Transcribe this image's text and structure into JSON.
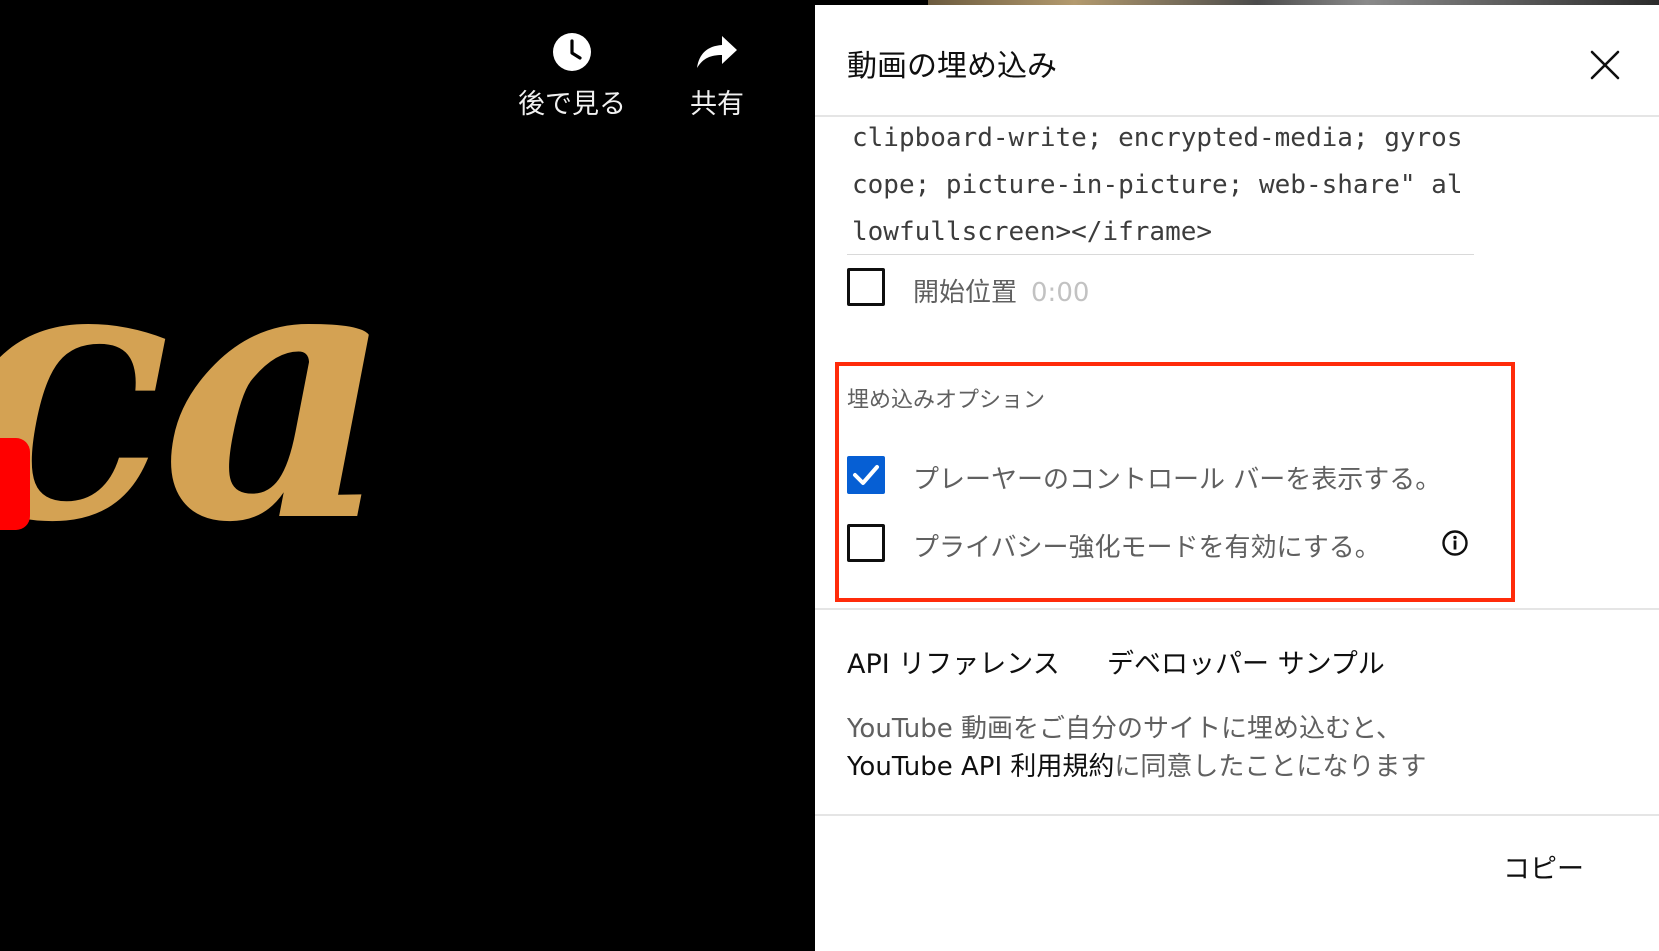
{
  "video": {
    "watch_later_label": "後で見る",
    "share_label": "共有",
    "logo_text": "ca"
  },
  "dialog": {
    "title": "動画の埋め込み",
    "embed_code": "clipboard-write; encrypted-media; gyroscope; picture-in-picture; web-share\" allowfullscreen></iframe>",
    "start_at": {
      "label": "開始位置",
      "time": "0:00",
      "checked": false
    },
    "options_title": "埋め込みオプション",
    "options": [
      {
        "label": "プレーヤーのコントロール バーを表示する。",
        "checked": true
      },
      {
        "label": "プライバシー強化モードを有効にする。",
        "checked": false
      }
    ],
    "links": {
      "api_reference": "API リファレンス",
      "developer_samples": "デベロッパー サンプル"
    },
    "terms": {
      "prefix": "YouTube 動画をご自分のサイトに埋め込むと、",
      "link": "YouTube API 利用規約",
      "suffix": "に同意したことになります"
    },
    "copy_label": "コピー"
  },
  "colors": {
    "accent": "#065fd4",
    "highlight_box": "#ff2b0a",
    "logo_gold": "#d4a253"
  }
}
